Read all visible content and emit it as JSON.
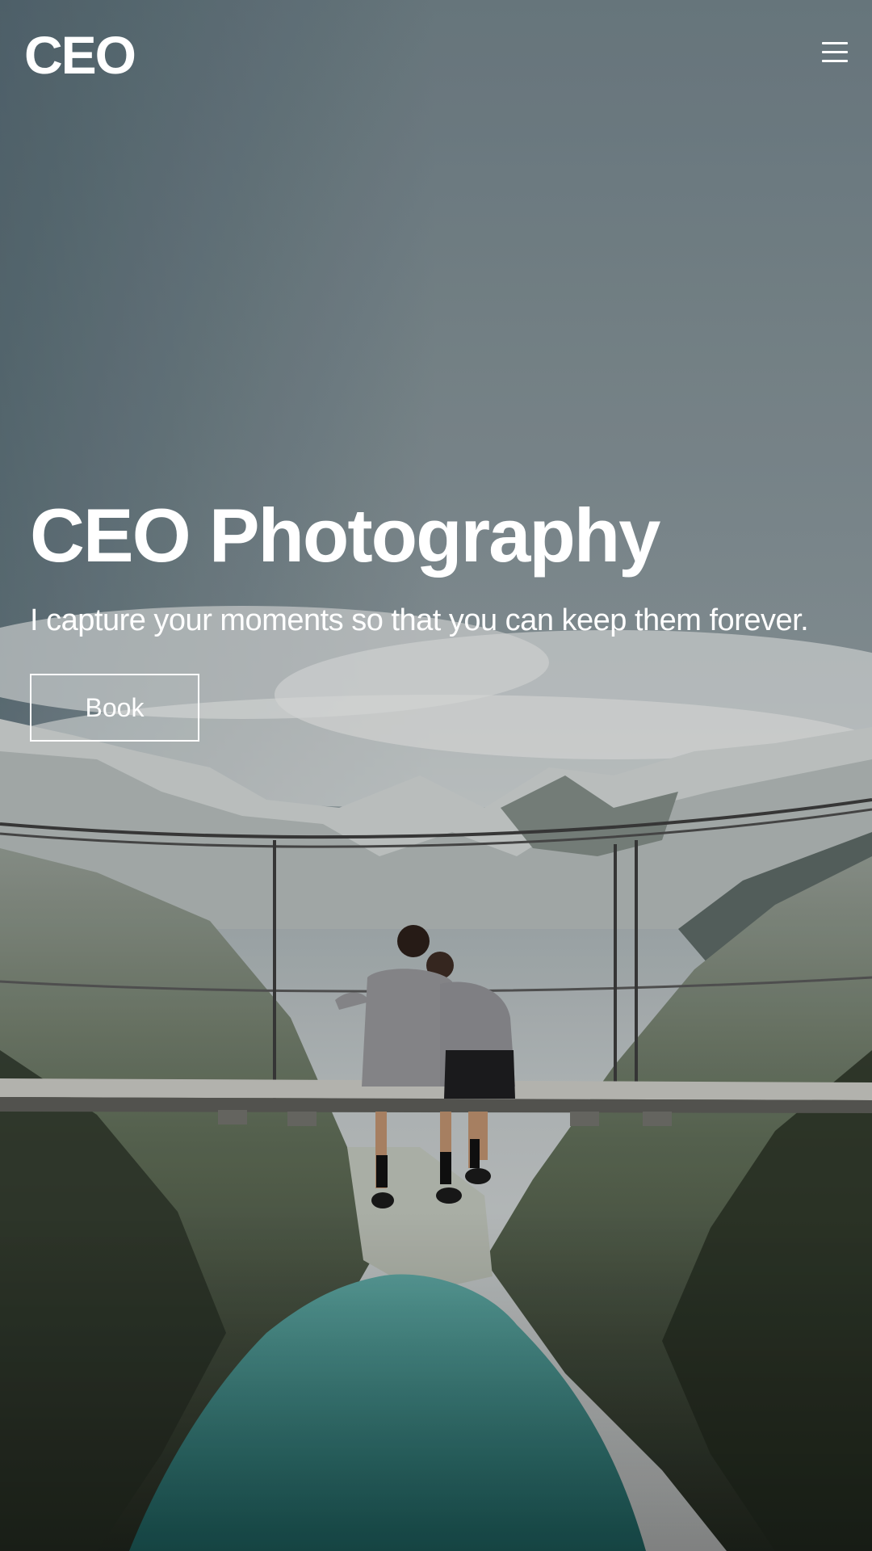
{
  "header": {
    "logo_text": "CEO",
    "menu_icon": "hamburger-menu-icon"
  },
  "hero": {
    "title": "CEO Photography",
    "subtitle": "I capture your moments so that you can keep them forever.",
    "book_label": "Book",
    "background": "photo of a couple sitting on a suspension bridge above a mountain valley with a turquoise lake"
  },
  "colors": {
    "text": "#ffffff",
    "sky": "#7f8c90",
    "lake": "#2f8a87",
    "mountain_dark": "#2b3328"
  }
}
